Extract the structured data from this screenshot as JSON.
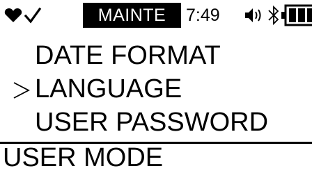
{
  "status_bar": {
    "icons": [
      "heart-icon",
      "check-icon",
      "speaker-icon",
      "bluetooth-icon",
      "battery-icon"
    ],
    "mode_label": "MAINTE",
    "time": "7:49"
  },
  "menu": {
    "items": [
      {
        "label": "DATE  FORMAT",
        "selected": false
      },
      {
        "label": "LANGUAGE",
        "selected": true
      },
      {
        "label": "USER  PASSWORD",
        "selected": false
      }
    ]
  },
  "footer": {
    "title": "USER  MODE"
  },
  "colors": {
    "foreground": "#000000",
    "background": "#ffffff"
  }
}
